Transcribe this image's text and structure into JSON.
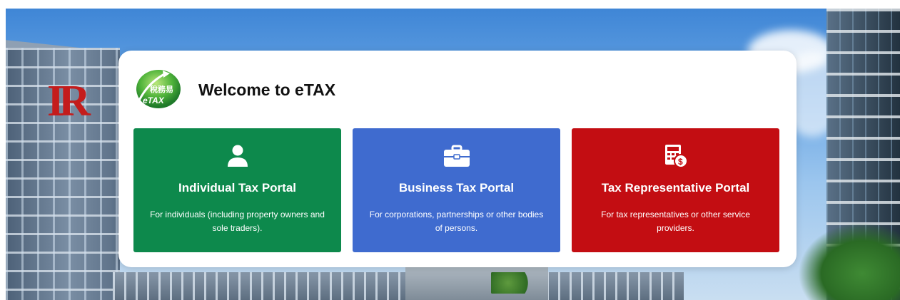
{
  "header": {
    "welcome_title": "Welcome to eTAX",
    "logo": {
      "icon": "etax-logo-icon",
      "chinese_text": "稅務易",
      "english_text": "eTAX"
    }
  },
  "background": {
    "building_logo_text": "IR"
  },
  "portals": [
    {
      "title": "Individual Tax Portal",
      "description": "For individuals (including property owners and sole traders).",
      "icon": "person-icon",
      "color": "#0d894c"
    },
    {
      "title": "Business Tax Portal",
      "description": "For corporations, partnerships or other bodies of persons.",
      "icon": "briefcase-icon",
      "color": "#3f6bcf"
    },
    {
      "title": "Tax Representative Portal",
      "description": "For tax representatives or other service providers.",
      "icon": "calculator-money-icon",
      "color": "#c30d12"
    }
  ]
}
